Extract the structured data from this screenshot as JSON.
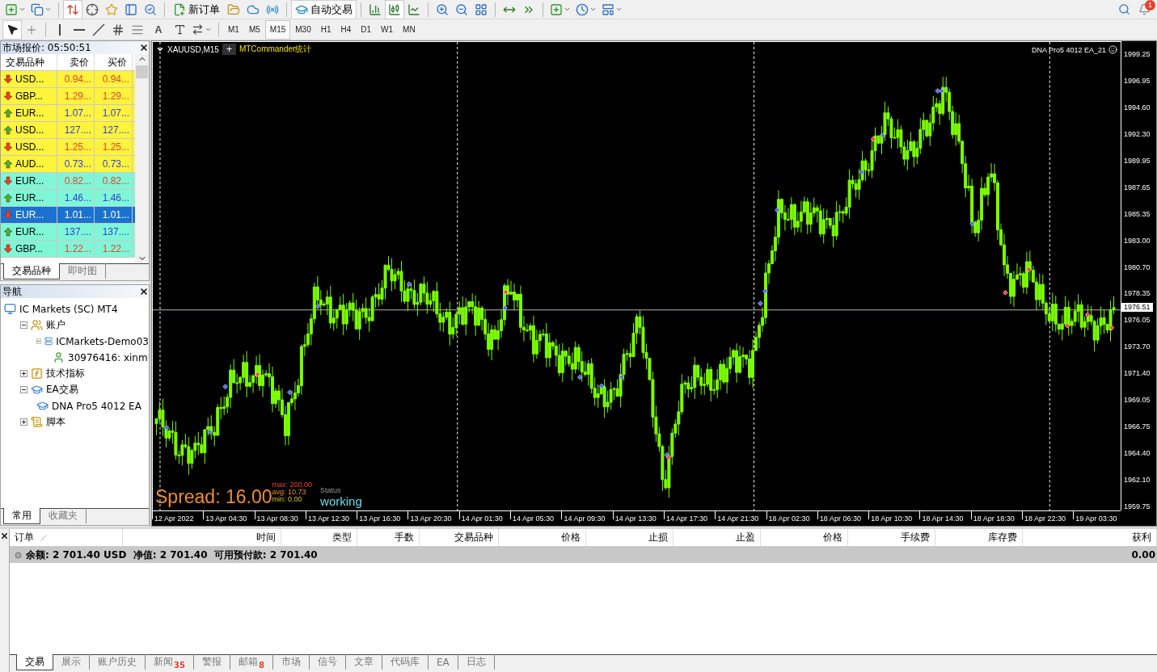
{
  "toolbar": {
    "new_order": "新订单",
    "auto_trading": "自动交易",
    "notification_count": "1"
  },
  "drawing_toolbar": {
    "text_tool": "A"
  },
  "timeframes": [
    {
      "label": "M1",
      "selected": false
    },
    {
      "label": "M5",
      "selected": false
    },
    {
      "label": "M15",
      "selected": true
    },
    {
      "label": "M30",
      "selected": false
    },
    {
      "label": "H1",
      "selected": false
    },
    {
      "label": "H4",
      "selected": false
    },
    {
      "label": "D1",
      "selected": false
    },
    {
      "label": "W1",
      "selected": false
    },
    {
      "label": "MN",
      "selected": false
    }
  ],
  "market_watch": {
    "title": "市场报价: 05:50:51",
    "columns": [
      "交易品种",
      "卖价",
      "买价"
    ],
    "rows": [
      {
        "symbol": "USD...",
        "bid": "0.94...",
        "ask": "0.94...",
        "rising": false,
        "color": "#fff43c",
        "selected": false
      },
      {
        "symbol": "GBP...",
        "bid": "1.29...",
        "ask": "1.29...",
        "rising": false,
        "color": "#fff43c",
        "selected": false
      },
      {
        "symbol": "EUR...",
        "bid": "1.07...",
        "ask": "1.07...",
        "rising": true,
        "color": "#fff43c",
        "selected": false
      },
      {
        "symbol": "USD...",
        "bid": "127....",
        "ask": "127....",
        "rising": true,
        "color": "#fff43c",
        "selected": false
      },
      {
        "symbol": "USD...",
        "bid": "1.25...",
        "ask": "1.25...",
        "rising": false,
        "color": "#fff43c",
        "selected": false
      },
      {
        "symbol": "AUD...",
        "bid": "0.73...",
        "ask": "0.73...",
        "rising": true,
        "color": "#fff43c",
        "selected": false
      },
      {
        "symbol": "EUR...",
        "bid": "0.82...",
        "ask": "0.82...",
        "rising": false,
        "color": "#7ff7d7",
        "selected": false
      },
      {
        "symbol": "EUR...",
        "bid": "1.46...",
        "ask": "1.46...",
        "rising": true,
        "color": "#7ff7d7",
        "selected": false
      },
      {
        "symbol": "EUR...",
        "bid": "1.01...",
        "ask": "1.01...",
        "rising": false,
        "selected": true
      },
      {
        "symbol": "EUR...",
        "bid": "137....",
        "ask": "137....",
        "rising": true,
        "color": "#7ff7d7",
        "selected": false
      },
      {
        "symbol": "GBP...",
        "bid": "1.22...",
        "ask": "1.22...",
        "rising": false,
        "color": "#7ff7d7",
        "selected": false
      }
    ],
    "tabs": [
      {
        "label": "交易品种",
        "selected": true
      },
      {
        "label": "即时图",
        "selected": false
      }
    ]
  },
  "navigator": {
    "title": "导航",
    "tree": [
      {
        "label": "IC Markets (SC) MT4",
        "kind": "platform",
        "children": [
          {
            "label": "账户",
            "kind": "accounts",
            "expanded": true,
            "children": [
              {
                "label": "ICMarkets-Demo03",
                "kind": "server",
                "expanded": true,
                "children": [
                  {
                    "label": "30976416: xinm",
                    "kind": "user"
                  }
                ]
              }
            ]
          },
          {
            "label": "技术指标",
            "kind": "indicators",
            "expanded": false
          },
          {
            "label": "EA交易",
            "kind": "experts",
            "expanded": true,
            "children": [
              {
                "label": "DNA Pro5 4012 EA",
                "kind": "expert"
              }
            ]
          },
          {
            "label": "脚本",
            "kind": "scripts",
            "expanded": false
          }
        ]
      }
    ],
    "tabs": [
      {
        "label": "常用",
        "selected": true
      },
      {
        "label": "收藏夹",
        "selected": false
      }
    ]
  },
  "chart": {
    "symbol": "XAUUSD,M15",
    "add_button": "+",
    "indicator": "MTCommander统计",
    "ea_label": "DNA Pro5 4012 EA_21",
    "spread": {
      "value": "Spread: 16.00",
      "max": "max: 200.00",
      "avg": "avg: 10.73",
      "min": "min: 0.00",
      "status_label": "Status",
      "status": "working"
    },
    "price_ticks": [
      "1999.25",
      "1996.95",
      "1994.60",
      "1992.30",
      "1989.95",
      "1987.65",
      "1985.35",
      "1983.00",
      "1980.70",
      "1978.35",
      "1976.05",
      "1973.70",
      "1971.40",
      "1969.05",
      "1966.75",
      "1964.40",
      "1962.10",
      "1959.75"
    ],
    "current_price": "1976.51",
    "time_ticks": [
      "12 Apr 2022",
      "13 Apr 04:30",
      "13 Apr 08:30",
      "13 Apr 12:30",
      "13 Apr 16:30",
      "13 Apr 20:30",
      "14 Apr 01:30",
      "14 Apr 05:30",
      "14 Apr 09:30",
      "14 Apr 13:30",
      "14 Apr 17:30",
      "14 Apr 21:30",
      "18 Apr 02:30",
      "18 Apr 06:30",
      "18 Apr 10:30",
      "18 Apr 14:30",
      "18 Apr 18:30",
      "18 Apr 22:30",
      "19 Apr 03:30"
    ]
  },
  "terminal": {
    "columns": [
      "订单",
      "时间",
      "类型",
      "手数",
      "交易品种",
      "价格",
      "止损",
      "止盈",
      "价格",
      "手续费",
      "库存费",
      "获利"
    ],
    "balance_line": "余额: 2 701.40 USD  净值: 2 701.40  可用预付款: 2 701.40",
    "profit": "0.00",
    "tabs": [
      {
        "label": "交易",
        "selected": true
      },
      {
        "label": "展示",
        "selected": false
      },
      {
        "label": "账户历史",
        "selected": false
      },
      {
        "label": "新闻",
        "badge": "35",
        "selected": false
      },
      {
        "label": "警报",
        "selected": false
      },
      {
        "label": "邮箱",
        "badge": "8",
        "selected": false
      },
      {
        "label": "市场",
        "selected": false
      },
      {
        "label": "信号",
        "selected": false
      },
      {
        "label": "文章",
        "selected": false
      },
      {
        "label": "代码库",
        "selected": false
      },
      {
        "label": "EA",
        "selected": false
      },
      {
        "label": "日志",
        "selected": false
      }
    ]
  }
}
